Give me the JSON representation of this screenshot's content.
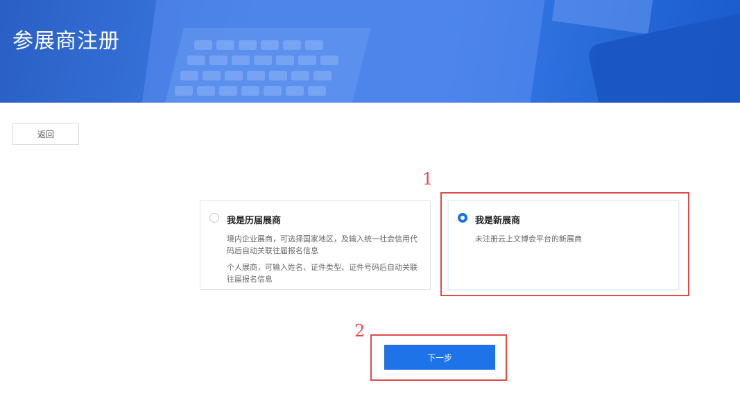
{
  "header": {
    "title": "参展商注册"
  },
  "back_button": {
    "label": "返回"
  },
  "options": [
    {
      "title": "我是历届展商",
      "desc1": "境内企业展商，可选择国家地区，及输入统一社会信用代码后自动关联往届报名信息",
      "desc2": "个人展商，可输入姓名、证件类型、证件号码后自动关联往届报名信息",
      "selected": false
    },
    {
      "title": "我是新展商",
      "desc1": "未注册云上文博会平台的新展商",
      "selected": true
    }
  ],
  "next_button": {
    "label": "下一步"
  },
  "annotations": {
    "one": "1",
    "two": "2",
    "color": "#e04a4a"
  },
  "colors": {
    "accent": "#1e73e8",
    "banner": "#3b7be3"
  }
}
